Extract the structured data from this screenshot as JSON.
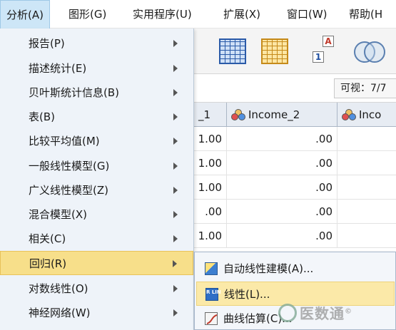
{
  "menubar": {
    "items": [
      {
        "label": "分析(A)",
        "active": true
      },
      {
        "label": "图形(G)"
      },
      {
        "label": "实用程序(U)"
      },
      {
        "label": "扩展(X)"
      },
      {
        "label": "窗口(W)"
      },
      {
        "label": "帮助(H"
      }
    ]
  },
  "toolbar": {
    "icons": [
      "data-grid-icon",
      "variable-grid-icon",
      "swap-values-icon",
      "venn-circles-icon"
    ],
    "swap_top": "A",
    "swap_bottom": "1"
  },
  "info": {
    "visible": "可视：7/7"
  },
  "grid": {
    "columns": [
      "_1",
      "Income_2",
      "Inco"
    ],
    "rows": [
      [
        "1.00",
        ".00",
        ""
      ],
      [
        "1.00",
        ".00",
        ""
      ],
      [
        "1.00",
        ".00",
        ""
      ],
      [
        ".00",
        ".00",
        ""
      ],
      [
        "1.00",
        ".00",
        ""
      ]
    ]
  },
  "dropdown": {
    "items": [
      {
        "label": "报告(P)",
        "submenu": true
      },
      {
        "label": "描述统计(E)",
        "submenu": true
      },
      {
        "label": "贝叶斯统计信息(B)",
        "submenu": true
      },
      {
        "label": "表(B)",
        "submenu": true
      },
      {
        "label": "比较平均值(M)",
        "submenu": true
      },
      {
        "label": "一般线性模型(G)",
        "submenu": true
      },
      {
        "label": "广义线性模型(Z)",
        "submenu": true
      },
      {
        "label": "混合模型(X)",
        "submenu": true
      },
      {
        "label": "相关(C)",
        "submenu": true
      },
      {
        "label": "回归(R)",
        "submenu": true,
        "highlight": true
      },
      {
        "label": "对数线性(O)",
        "submenu": true
      },
      {
        "label": "神经网络(W)",
        "submenu": true
      }
    ]
  },
  "submenu": {
    "items": [
      {
        "label": "自动线性建模(A)...",
        "icon": "auto-linear-icon"
      },
      {
        "label": "线性(L)...",
        "icon": "linear-icon",
        "icon_text": "R LIN",
        "highlight": true
      },
      {
        "label": "曲线估算(C)...",
        "icon": "curve-icon"
      }
    ]
  },
  "watermark": {
    "text": "医数通",
    "symbol": "©"
  },
  "colors": {
    "menu_active": "#cde6f7",
    "dropdown_bg": "#eef3f9",
    "highlight": "#f7df8a",
    "grid_header": "#e7ecf3"
  }
}
